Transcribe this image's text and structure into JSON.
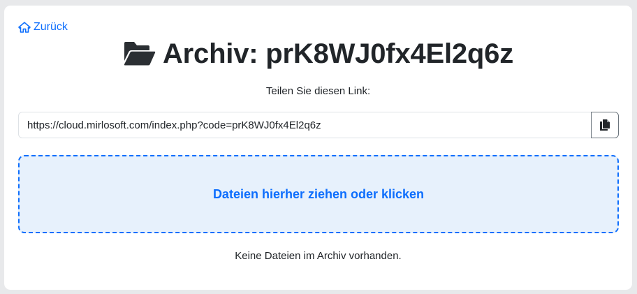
{
  "back_link": {
    "label": "Zurück",
    "icon": "home-icon"
  },
  "header": {
    "title": "Archiv: prK8WJ0fx4El2q6z",
    "icon": "folder-open-icon"
  },
  "share": {
    "label": "Teilen Sie diesen Link:",
    "url": "https://cloud.mirlosoft.com/index.php?code=prK8WJ0fx4El2q6z",
    "copy_icon": "copy-icon"
  },
  "dropzone": {
    "label": "Dateien hierher ziehen oder klicken"
  },
  "files": {
    "empty_message": "Keine Dateien im Archiv vorhanden."
  },
  "colors": {
    "accent": "#0d6efd",
    "dropzone_bg": "#e7f1fc",
    "text": "#212529",
    "page_bg": "#e8e9eb"
  }
}
